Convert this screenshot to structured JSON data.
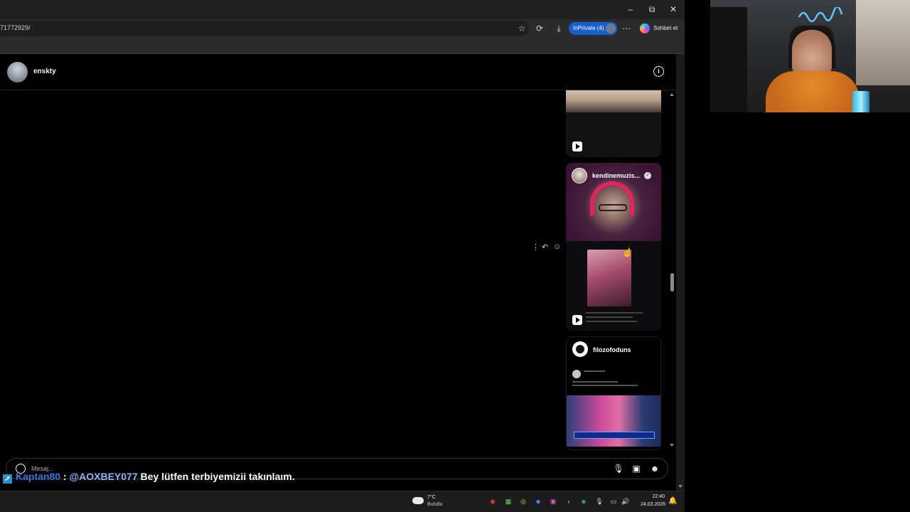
{
  "browser": {
    "url": "71772929/",
    "inprivate_label": "InPrivate (4)",
    "copilot_label": "Sohbet et",
    "window_controls": [
      "–",
      "⧉",
      "✕"
    ]
  },
  "dm": {
    "contact_name": "enskty",
    "messages": [
      {
        "type": "reel",
        "owner": ""
      },
      {
        "type": "reel",
        "owner": "kendinemuzis..."
      },
      {
        "type": "post",
        "owner": "filozofoduns"
      }
    ],
    "composer_placeholder": "Mesaj..."
  },
  "stream_chat": {
    "username": "Kaptan80",
    "separator": ":",
    "mention": "@AOXBEY077",
    "text": "Bey lütfen terbiyemizii takınlaım."
  },
  "taskbar": {
    "temperature": "7°C",
    "weather": "Bulutlu",
    "time": "22:40",
    "date": "24.03.2026"
  },
  "colors": {
    "inprivate": "#1a5fd0",
    "chat_user": "#3f7ddf",
    "background": "#000000"
  }
}
